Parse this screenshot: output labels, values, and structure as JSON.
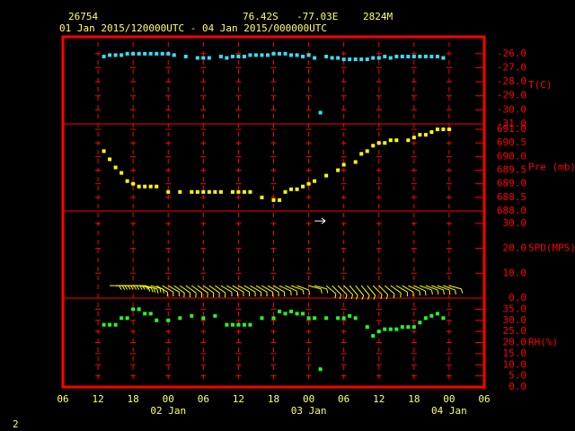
{
  "header": {
    "station": "26754",
    "lat": "76.42S",
    "lon": "-77.03E",
    "elev": "2824M",
    "range": "01 Jan 2015/120000UTC - 04 Jan 2015/000000UTC"
  },
  "corner_label": "2",
  "colors": {
    "frame": "#ff0000",
    "grid": "#ff0000",
    "text": "#ffff66",
    "temp": "#33e0ff",
    "pres": "#ffff00",
    "wind": "#ffff00",
    "wind_outlier": "#ffffff",
    "rh": "#22ff22"
  },
  "chart_data": {
    "type": "scatter",
    "x_unit": "hours since 01 Jan 2015 06 UTC",
    "x_range": [
      0,
      72
    ],
    "x_ticks": [
      {
        "h": 0,
        "label": "06"
      },
      {
        "h": 6,
        "label": "12"
      },
      {
        "h": 12,
        "label": "18"
      },
      {
        "h": 18,
        "label": "00"
      },
      {
        "h": 24,
        "label": "06"
      },
      {
        "h": 30,
        "label": "12"
      },
      {
        "h": 36,
        "label": "18"
      },
      {
        "h": 42,
        "label": "00"
      },
      {
        "h": 48,
        "label": "06"
      },
      {
        "h": 54,
        "label": "12"
      },
      {
        "h": 60,
        "label": "18"
      },
      {
        "h": 66,
        "label": "00"
      },
      {
        "h": 72,
        "label": "06"
      }
    ],
    "day_labels": [
      {
        "h": 18,
        "label": "02 Jan"
      },
      {
        "h": 42,
        "label": "03 Jan"
      },
      {
        "h": 66,
        "label": "04 Jan"
      }
    ],
    "panels": [
      {
        "id": "temp",
        "label": "T(C)",
        "ylim": [
          -31,
          -25.5
        ],
        "ticks": [
          -26,
          -27,
          -28,
          -29,
          -30,
          -31
        ],
        "tick_labels": [
          "-26.0",
          "-27.0",
          "-28.0",
          "-29.0",
          "-30.0",
          "-31.0"
        ],
        "x": [
          7,
          8,
          9,
          10,
          11,
          12,
          13,
          14,
          15,
          16,
          17,
          18,
          19,
          21,
          23,
          24,
          25,
          27,
          28,
          29,
          30,
          31,
          32,
          33,
          34,
          35,
          36,
          37,
          38,
          39,
          40,
          41,
          42,
          43,
          44,
          45,
          46,
          47,
          48,
          49,
          50,
          51,
          52,
          53,
          54,
          55,
          56,
          57,
          58,
          59,
          60,
          61,
          62,
          63,
          64,
          65
        ],
        "y": [
          -26.2,
          -26.1,
          -26.1,
          -26.1,
          -26.0,
          -26.0,
          -26.0,
          -26.0,
          -26.0,
          -26.0,
          -26.0,
          -26.0,
          -26.1,
          -26.2,
          -26.3,
          -26.3,
          -26.3,
          -26.2,
          -26.3,
          -26.2,
          -26.2,
          -26.2,
          -26.1,
          -26.1,
          -26.1,
          -26.1,
          -26.0,
          -26.0,
          -26.0,
          -26.1,
          -26.1,
          -26.2,
          -26.1,
          -26.3,
          -30.2,
          -26.2,
          -26.3,
          -26.3,
          -26.4,
          -26.4,
          -26.4,
          -26.4,
          -26.4,
          -26.3,
          -26.3,
          -26.2,
          -26.3,
          -26.2,
          -26.2,
          -26.2,
          -26.2,
          -26.2,
          -26.2,
          -26.2,
          -26.2,
          -26.3
        ]
      },
      {
        "id": "pres",
        "label": "Pre (mb)",
        "ylim": [
          688,
          691.2
        ],
        "ticks": [
          688,
          688.5,
          689,
          689.5,
          690,
          690.5,
          691
        ],
        "tick_labels": [
          "688.0",
          "688.5",
          "689.0",
          "689.5",
          "690.0",
          "690.5",
          "691.0"
        ],
        "x": [
          7,
          8,
          9,
          10,
          11,
          12,
          13,
          14,
          15,
          16,
          18,
          20,
          22,
          23,
          24,
          25,
          26,
          27,
          29,
          30,
          31,
          32,
          34,
          36,
          37,
          38,
          39,
          40,
          41,
          42,
          43,
          45,
          47,
          48,
          50,
          51,
          52,
          53,
          54,
          55,
          56,
          57,
          59,
          60,
          61,
          62,
          63,
          64,
          65,
          66
        ],
        "y": [
          690.2,
          689.9,
          689.6,
          689.4,
          689.1,
          689.0,
          688.9,
          688.9,
          688.9,
          688.9,
          688.7,
          688.7,
          688.7,
          688.7,
          688.7,
          688.7,
          688.7,
          688.7,
          688.7,
          688.7,
          688.7,
          688.7,
          688.5,
          688.4,
          688.4,
          688.7,
          688.8,
          688.8,
          688.9,
          689.0,
          689.1,
          689.3,
          689.5,
          689.7,
          689.8,
          690.1,
          690.2,
          690.4,
          690.5,
          690.5,
          690.6,
          690.6,
          690.6,
          690.7,
          690.8,
          690.8,
          690.9,
          691.0,
          691.0,
          691.0
        ]
      },
      {
        "id": "wind",
        "label": "SPD(MPS)",
        "ylim": [
          0,
          35
        ],
        "ticks": [
          0,
          10,
          20,
          30
        ],
        "tick_labels": [
          "0.0",
          "10.0",
          "20.0",
          "30.0"
        ],
        "x": [
          8,
          9,
          10,
          11,
          12,
          13,
          14,
          15,
          16,
          17,
          18,
          19,
          20,
          21,
          22,
          23,
          24,
          25,
          26,
          27,
          28,
          29,
          30,
          31,
          32,
          33,
          34,
          35,
          36,
          37,
          38,
          39,
          40,
          42,
          43,
          45,
          46,
          47,
          48,
          49,
          50,
          51,
          52,
          53,
          54,
          55,
          56,
          57,
          58,
          59,
          60,
          61,
          62,
          63,
          64,
          65,
          66
        ],
        "dir_deg": [
          270,
          270,
          270,
          270,
          270,
          280,
          285,
          285,
          300,
          300,
          300,
          305,
          305,
          305,
          305,
          305,
          305,
          305,
          305,
          300,
          300,
          300,
          300,
          300,
          300,
          300,
          300,
          300,
          300,
          295,
          295,
          290,
          290,
          285,
          285,
          310,
          315,
          315,
          315,
          320,
          320,
          320,
          320,
          315,
          315,
          310,
          305,
          300,
          300,
          295,
          295,
          290,
          290,
          290,
          290,
          290,
          285
        ],
        "speed": [
          8,
          8,
          8,
          8,
          8,
          8,
          8,
          8,
          6,
          6,
          6,
          6,
          6,
          6,
          6,
          6,
          6,
          6,
          6,
          6,
          6,
          6,
          6,
          5,
          5,
          5,
          5,
          4,
          4,
          4,
          4,
          5,
          5,
          5,
          5,
          6,
          6,
          6,
          6,
          6,
          6,
          6,
          6,
          6,
          6,
          6,
          6,
          6,
          6,
          6,
          6,
          6,
          6,
          6,
          6,
          6,
          6
        ],
        "outlier": {
          "x": 43,
          "speed": 31,
          "dir_deg": 270
        }
      },
      {
        "id": "rh",
        "label": "RH(%)",
        "ylim": [
          0,
          40
        ],
        "ticks": [
          0,
          5,
          10,
          15,
          20,
          25,
          30,
          35
        ],
        "tick_labels": [
          "0.0",
          "5.0",
          "10.0",
          "15.0",
          "20.0",
          "25.0",
          "30.0",
          "35.0"
        ],
        "x": [
          7,
          8,
          9,
          10,
          11,
          12,
          13,
          14,
          15,
          16,
          18,
          20,
          22,
          24,
          26,
          28,
          29,
          30,
          31,
          32,
          34,
          36,
          37,
          38,
          39,
          40,
          41,
          42,
          43,
          44,
          45,
          47,
          48,
          49,
          50,
          52,
          53,
          54,
          55,
          56,
          57,
          58,
          59,
          60,
          61,
          62,
          63,
          64,
          65
        ],
        "y": [
          28,
          28,
          28,
          31,
          31,
          35,
          35,
          33,
          33,
          30,
          30,
          31,
          32,
          31,
          32,
          28,
          28,
          28,
          28,
          28,
          31,
          31,
          34,
          33,
          34,
          33,
          33,
          31,
          31,
          8,
          31,
          31,
          31,
          32,
          31,
          27,
          23,
          25,
          26,
          26,
          26,
          27,
          27,
          27,
          29,
          31,
          32,
          33,
          31
        ]
      }
    ]
  }
}
